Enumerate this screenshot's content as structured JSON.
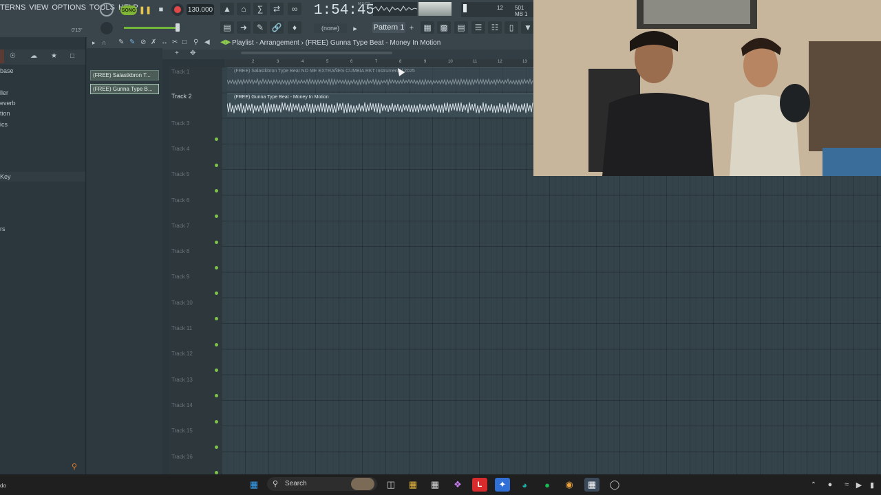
{
  "menu": [
    "TERNS",
    "VIEW",
    "OPTIONS",
    "TOOLS",
    "HELP"
  ],
  "transport": {
    "song_label": "SONG",
    "tempo": "130.000",
    "time": "1:54:45",
    "time_unit": "M:S:CS",
    "cpu": "12",
    "memory": "501 MB",
    "memory_sub": "1",
    "elapsed_small": "0'13\"",
    "pattern": "Pattern 1",
    "none_box": "(none)"
  },
  "browser": {
    "items": [
      "base",
      "ller",
      "everb",
      "tion",
      "ics",
      "Key",
      "rs"
    ]
  },
  "picker": {
    "clips": [
      "(FREE) Salastkbron T...",
      "(FREE) Gunna Type B..."
    ]
  },
  "playlist": {
    "title": "Playlist - Arrangement",
    "title_sep": "›",
    "current_clip": "(FREE) Gunna Type Beat - Money In Motion",
    "ruler": [
      "2",
      "3",
      "4",
      "5",
      "6",
      "7",
      "8",
      "9",
      "10",
      "11",
      "12",
      "13"
    ],
    "tracks": [
      "Track 1",
      "Track 2",
      "Track 3",
      "Track 4",
      "Track 5",
      "Track 6",
      "Track 7",
      "Track 8",
      "Track 9",
      "Track 10",
      "Track 11",
      "Track 12",
      "Track 13",
      "Track 14",
      "Track 15",
      "Track 16"
    ],
    "audio_clips": [
      {
        "name": "(FREE) Salastkbron Type Beat NO ME EXTRAÑES CUMBIA RKT Instrumental 2025"
      },
      {
        "name": "(FREE) Gunna Type Beat - Money In Motion"
      }
    ]
  },
  "taskbar": {
    "search": "Search",
    "left_text": "do"
  },
  "colors": {
    "accent_green": "#7fb437",
    "record_red": "#e34848",
    "grid_bg": "#34424a"
  }
}
